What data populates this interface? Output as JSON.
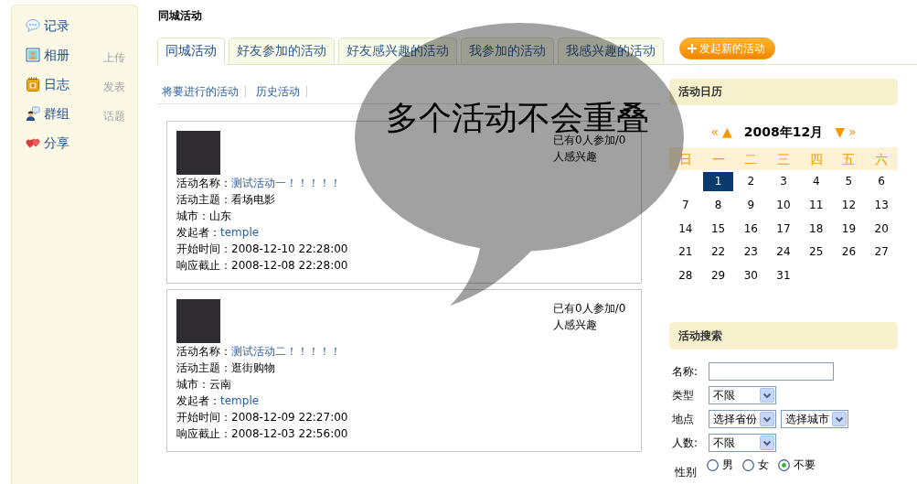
{
  "sidebar": {
    "items": [
      {
        "label": "记录"
      },
      {
        "label": "相册",
        "action": "上传"
      },
      {
        "label": "日志",
        "action": "发表"
      },
      {
        "label": "群组",
        "action": "话题"
      },
      {
        "label": "分享"
      }
    ]
  },
  "page_title": "同城活动",
  "tabs": [
    {
      "label": "同城活动",
      "selected": true
    },
    {
      "label": "好友参加的活动",
      "selected": false
    },
    {
      "label": "好友感兴趣的活动",
      "selected": false
    },
    {
      "label": "我参加的活动",
      "selected": false
    },
    {
      "label": "我感兴趣的活动",
      "selected": false
    }
  ],
  "new_activity_button": {
    "label": "发起新的活动"
  },
  "filters": [
    "将要进行的活动",
    "历史活动"
  ],
  "activities": [
    {
      "fields": [
        {
          "kind": "link",
          "label": "活动名称：",
          "value": "测试活动一！！！！！"
        },
        {
          "kind": "text",
          "label": "活动主题：",
          "value": "看场电影"
        },
        {
          "kind": "text",
          "label": "城市：",
          "value": "山东"
        },
        {
          "kind": "link",
          "label": "发起者：",
          "value": "temple"
        },
        {
          "kind": "text",
          "label": "开始时间：",
          "value": "2008-12-10 22:28:00"
        },
        {
          "kind": "text",
          "label": "响应截止：",
          "value": "2008-12-08 22:28:00"
        }
      ],
      "participation": "已有0人参加/0人感兴趣"
    },
    {
      "fields": [
        {
          "kind": "link",
          "label": "活动名称：",
          "value": "测试活动二！！！！！"
        },
        {
          "kind": "text",
          "label": "活动主题：",
          "value": "逛街购物"
        },
        {
          "kind": "text",
          "label": "城市：",
          "value": "云南"
        },
        {
          "kind": "link",
          "label": "发起者：",
          "value": "temple"
        },
        {
          "kind": "text",
          "label": "开始时间：",
          "value": "2008-12-09 22:27:00"
        },
        {
          "kind": "text",
          "label": "响应截止：",
          "value": "2008-12-03 22:56:00"
        }
      ],
      "participation": "已有0人参加/0人感兴趣"
    }
  ],
  "calendar": {
    "title": "活动日历",
    "nav": {
      "prev_year": "«",
      "prev_month": "▲",
      "month": "2008年12月",
      "next_month": "▼",
      "next_year": "»"
    },
    "weekdays": [
      "日",
      "一",
      "二",
      "三",
      "四",
      "五",
      "六"
    ],
    "weeks": [
      [
        {
          "day": "1",
          "selected": true
        },
        {
          "day": "2",
          "selected": false
        },
        {
          "day": "3",
          "selected": false
        },
        {
          "day": "4",
          "selected": false
        },
        {
          "day": "5",
          "selected": false
        },
        {
          "day": "6",
          "selected": false
        }
      ],
      [
        {
          "day": "7",
          "selected": false
        },
        {
          "day": "8",
          "selected": false
        },
        {
          "day": "9",
          "selected": false
        },
        {
          "day": "10",
          "selected": false
        },
        {
          "day": "11",
          "selected": false
        },
        {
          "day": "12",
          "selected": false
        },
        {
          "day": "13",
          "selected": false
        }
      ],
      [
        {
          "day": "14",
          "selected": false
        },
        {
          "day": "15",
          "selected": false
        },
        {
          "day": "16",
          "selected": false
        },
        {
          "day": "17",
          "selected": false
        },
        {
          "day": "18",
          "selected": false
        },
        {
          "day": "19",
          "selected": false
        },
        {
          "day": "20",
          "selected": false
        }
      ],
      [
        {
          "day": "21",
          "selected": false
        },
        {
          "day": "22",
          "selected": false
        },
        {
          "day": "23",
          "selected": false
        },
        {
          "day": "24",
          "selected": false
        },
        {
          "day": "25",
          "selected": false
        },
        {
          "day": "26",
          "selected": false
        },
        {
          "day": "27",
          "selected": false
        }
      ],
      [
        {
          "day": "28",
          "selected": false
        },
        {
          "day": "29",
          "selected": false
        },
        {
          "day": "30",
          "selected": false
        },
        {
          "day": "31",
          "selected": false
        }
      ]
    ]
  },
  "search": {
    "title": "活动搜索",
    "rows": [
      {
        "kind": "text",
        "label": "名称:"
      },
      {
        "kind": "select",
        "label": "类型",
        "values": [
          "不限"
        ]
      },
      {
        "kind": "select",
        "label": "地点",
        "values": [
          "选择省份",
          "选择城市"
        ]
      },
      {
        "kind": "select",
        "label": "人数:",
        "values": [
          "不限"
        ]
      },
      {
        "kind": "radio",
        "label": "性别",
        "options": [
          {
            "label": "男",
            "selected": false
          },
          {
            "label": "女",
            "selected": false
          },
          {
            "label": "不要",
            "selected": true
          }
        ]
      }
    ]
  },
  "callout": {
    "text": "多个活动不会重叠"
  }
}
